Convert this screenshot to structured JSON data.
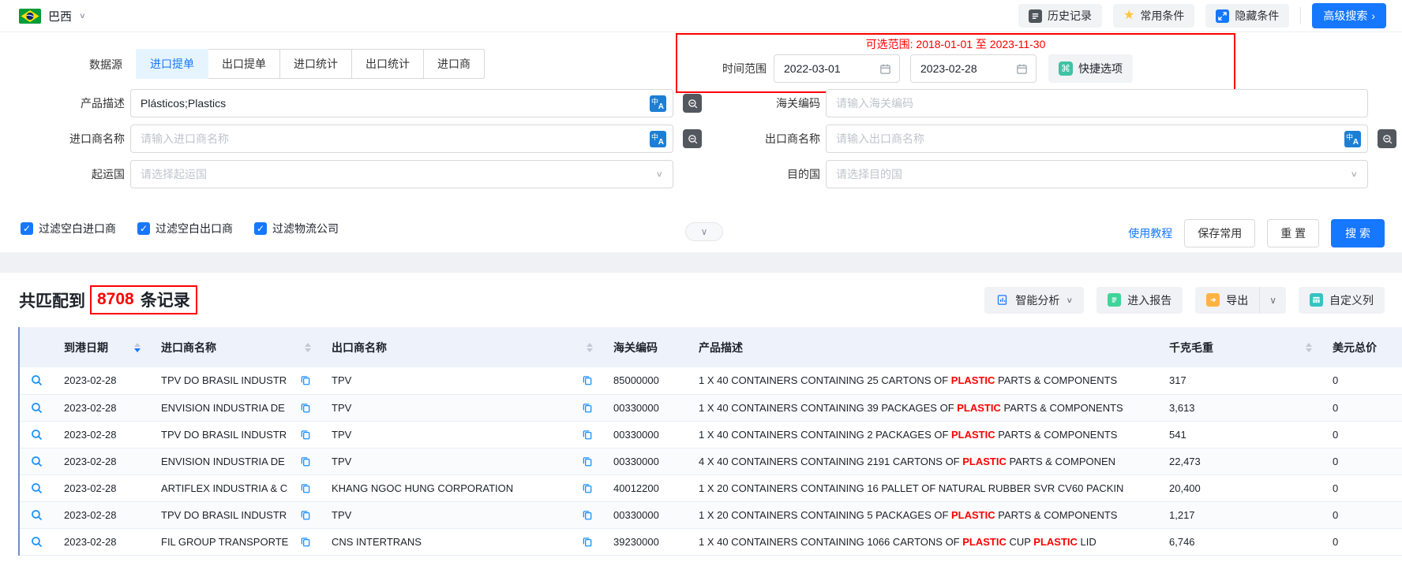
{
  "icons": {
    "check": "✓",
    "chevron_down": "∨",
    "arrow_right": "›",
    "star": "★",
    "command": "⌘"
  },
  "topbar": {
    "country": "巴西",
    "history_label": "历史记录",
    "favorites_label": "常用条件",
    "hide_label": "隐藏条件",
    "advanced_label": "高级搜索"
  },
  "form": {
    "datasource_label": "数据源",
    "tabs": [
      {
        "label": "进口提单",
        "active": true
      },
      {
        "label": "出口提单",
        "active": false
      },
      {
        "label": "进口统计",
        "active": false
      },
      {
        "label": "出口统计",
        "active": false
      },
      {
        "label": "进口商",
        "active": false
      }
    ],
    "time": {
      "hint": "可选范围: 2018-01-01 至 2023-11-30",
      "label": "时间范围",
      "start": "2022-03-01",
      "end": "2023-02-28",
      "quick_label": "快捷选项"
    },
    "fields": {
      "product_label": "产品描述",
      "product_value": "Plásticos;Plastics",
      "hs_label": "海关编码",
      "hs_placeholder": "请输入海关编码",
      "importer_label": "进口商名称",
      "importer_placeholder": "请输入进口商名称",
      "exporter_label": "出口商名称",
      "exporter_placeholder": "请输入出口商名称",
      "origin_label": "起运国",
      "origin_placeholder": "请选择起运国",
      "dest_label": "目的国",
      "dest_placeholder": "请选择目的国"
    },
    "checkboxes": [
      {
        "label": "过滤空白进口商",
        "checked": true
      },
      {
        "label": "过滤空白出口商",
        "checked": true
      },
      {
        "label": "过滤物流公司",
        "checked": true
      }
    ],
    "actions": {
      "tutorial": "使用教程",
      "save": "保存常用",
      "reset": "重 置",
      "search": "搜 索"
    }
  },
  "results": {
    "count_prefix": "共匹配到",
    "count": "8708",
    "count_suffix": "条记录",
    "toolbar": {
      "analyze": "智能分析",
      "report": "进入报告",
      "export": "导出",
      "customize": "自定义列"
    },
    "table": {
      "columns": [
        {
          "key": "search",
          "label": "",
          "sortable": false
        },
        {
          "key": "date",
          "label": "到港日期",
          "sortable": true,
          "sort": "desc"
        },
        {
          "key": "importer",
          "label": "进口商名称",
          "sortable": true,
          "sort": null
        },
        {
          "key": "exporter",
          "label": "出口商名称",
          "sortable": true,
          "sort": null
        },
        {
          "key": "hs",
          "label": "海关编码",
          "sortable": false
        },
        {
          "key": "desc",
          "label": "产品描述",
          "sortable": false
        },
        {
          "key": "weight",
          "label": "千克毛重",
          "sortable": true,
          "sort": null
        },
        {
          "key": "value",
          "label": "美元总价",
          "sortable": false
        }
      ],
      "rows": [
        {
          "date": "2023-02-28",
          "importer": "TPV DO BRASIL INDUSTR",
          "exporter": "TPV",
          "hs": "85000000",
          "desc": [
            {
              "text": "1 X 40 CONTAINERS CONTAINING 25 CARTONS OF ",
              "hl": false
            },
            {
              "text": "PLASTIC",
              "hl": true
            },
            {
              "text": " PARTS & COMPONENTS",
              "hl": false
            }
          ],
          "weight": "317",
          "value": "0"
        },
        {
          "date": "2023-02-28",
          "importer": "ENVISION INDUSTRIA DE",
          "exporter": "TPV",
          "hs": "00330000",
          "desc": [
            {
              "text": "1 X 40 CONTAINERS CONTAINING 39 PACKAGES OF ",
              "hl": false
            },
            {
              "text": "PLASTIC",
              "hl": true
            },
            {
              "text": " PARTS & COMPONENTS",
              "hl": false
            }
          ],
          "weight": "3,613",
          "value": "0"
        },
        {
          "date": "2023-02-28",
          "importer": "TPV DO BRASIL INDUSTR",
          "exporter": "TPV",
          "hs": "00330000",
          "desc": [
            {
              "text": "1 X 40 CONTAINERS CONTAINING 2 PACKAGES OF ",
              "hl": false
            },
            {
              "text": "PLASTIC",
              "hl": true
            },
            {
              "text": " PARTS & COMPONENTS",
              "hl": false
            }
          ],
          "weight": "541",
          "value": "0"
        },
        {
          "date": "2023-02-28",
          "importer": "ENVISION INDUSTRIA DE",
          "exporter": "TPV",
          "hs": "00330000",
          "desc": [
            {
              "text": "4 X 40 CONTAINERS CONTAINING 2191 CARTONS OF ",
              "hl": false
            },
            {
              "text": "PLASTIC",
              "hl": true
            },
            {
              "text": " PARTS & COMPONEN",
              "hl": false
            }
          ],
          "weight": "22,473",
          "value": "0"
        },
        {
          "date": "2023-02-28",
          "importer": "ARTIFLEX INDUSTRIA & C",
          "exporter": "KHANG NGOC HUNG CORPORATION",
          "hs": "40012200",
          "desc": [
            {
              "text": "1 X 20 CONTAINERS CONTAINING 16 PALLET OF NATURAL RUBBER SVR CV60 PACKIN",
              "hl": false
            }
          ],
          "weight": "20,400",
          "value": "0"
        },
        {
          "date": "2023-02-28",
          "importer": "TPV DO BRASIL INDUSTR",
          "exporter": "TPV",
          "hs": "00330000",
          "desc": [
            {
              "text": "1 X 20 CONTAINERS CONTAINING 5 PACKAGES OF ",
              "hl": false
            },
            {
              "text": "PLASTIC",
              "hl": true
            },
            {
              "text": " PARTS & COMPONENTS",
              "hl": false
            }
          ],
          "weight": "1,217",
          "value": "0"
        },
        {
          "date": "2023-02-28",
          "importer": "FIL GROUP TRANSPORTE",
          "exporter": "CNS INTERTRANS",
          "hs": "39230000",
          "desc": [
            {
              "text": "1 X 40 CONTAINERS CONTAINING 1066 CARTONS OF ",
              "hl": false
            },
            {
              "text": "PLASTIC",
              "hl": true
            },
            {
              "text": " CUP ",
              "hl": false
            },
            {
              "text": "PLASTIC",
              "hl": true
            },
            {
              "text": " LID",
              "hl": false
            }
          ],
          "weight": "6,746",
          "value": "0"
        }
      ]
    }
  }
}
